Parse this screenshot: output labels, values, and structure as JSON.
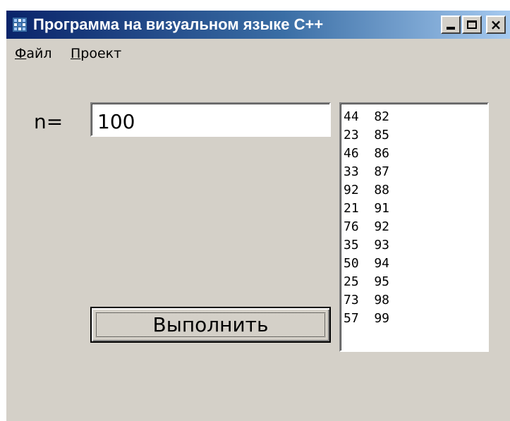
{
  "window": {
    "title": "Программа на визуальном языке C++",
    "buttons": {
      "minimize": "minimize",
      "maximize": "maximize",
      "close": "×"
    },
    "title_color_start": "#0a246a",
    "title_color_end": "#a6caf0"
  },
  "menu": {
    "file": {
      "accel": "Ф",
      "rest": "айл"
    },
    "project": {
      "accel": "П",
      "rest": "роект"
    }
  },
  "form": {
    "n_label": "n=",
    "n_value": "100",
    "run_button": "Выполнить"
  },
  "list": [
    "44  82",
    "23  85",
    "46  86",
    "33  87",
    "92  88",
    "21  91",
    "76  92",
    "35  93",
    "50  94",
    "25  95",
    "73  98",
    "57  99"
  ]
}
